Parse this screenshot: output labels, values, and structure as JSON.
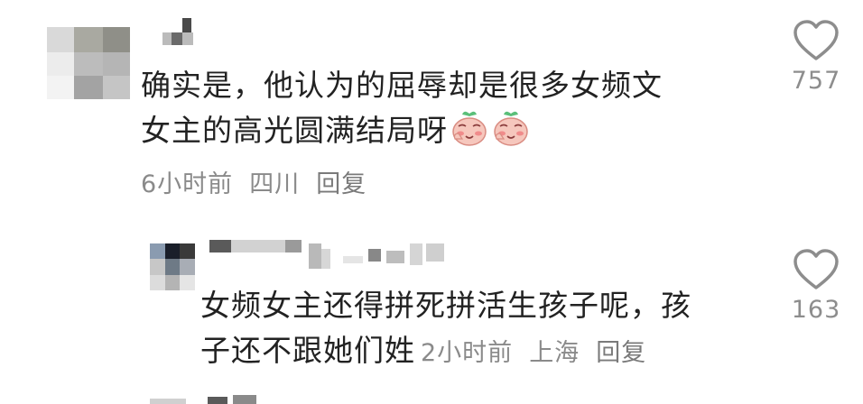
{
  "comment": {
    "text_line1": "确实是，他认为的屈辱却是很多女频文",
    "text_line2": "女主的高光圆满结局呀",
    "emoji_icon": "blushing-peach-emoji",
    "time": "6小时前",
    "location": "四川",
    "reply_label": "回复",
    "like_count": "757"
  },
  "reply": {
    "text_line1": "女频女主还得拼死拼活生孩子呢，孩",
    "text_line2": "子还不跟她们姓",
    "time": "2小时前",
    "location": "上海",
    "reply_label": "回复",
    "like_count": "163"
  },
  "colors": {
    "text": "#222222",
    "meta": "#8a8a8a",
    "heart_outline": "#8d8d8d"
  }
}
